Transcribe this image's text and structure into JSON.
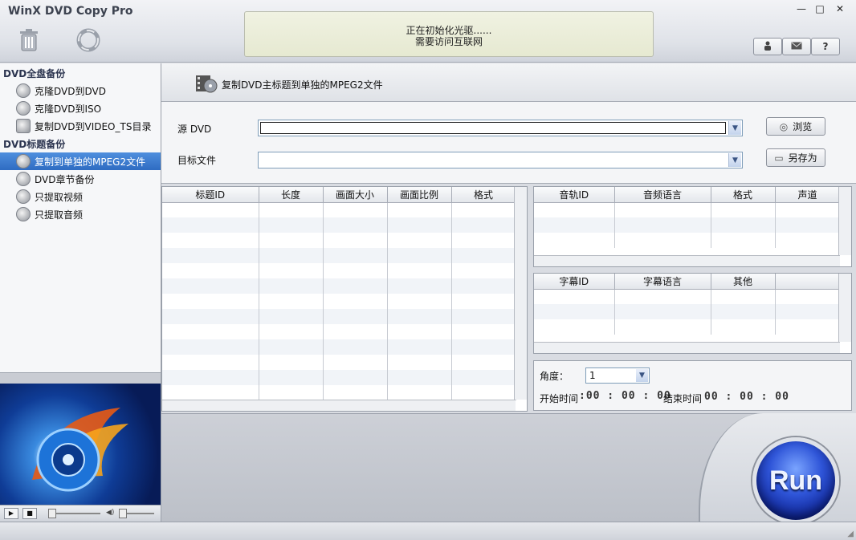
{
  "app": {
    "title": "WinX DVD Copy Pro"
  },
  "toolbar": {
    "delete_icon": "trash-icon",
    "refresh_icon": "refresh-icon"
  },
  "status": {
    "line1": "正在初始化光驱......",
    "line2": "需要访问互联网"
  },
  "window_controls": {
    "minimize": "—",
    "maximize": "□",
    "close": "✕"
  },
  "top_buttons": {
    "user_icon": "user-icon",
    "mail_icon": "mail-icon",
    "help": "?"
  },
  "sidebar": {
    "section1": "DVD全盘备份",
    "section1_items": [
      {
        "label": "克隆DVD到DVD",
        "icon": "disc-icon"
      },
      {
        "label": "克隆DVD到ISO",
        "icon": "iso-icon"
      },
      {
        "label": "复制DVD到VIDEO_TS目录",
        "icon": "folder-icon"
      }
    ],
    "section2": "DVD标题备份",
    "section2_items": [
      {
        "label": "复制到单独的MPEG2文件",
        "icon": "film-icon",
        "selected": true
      },
      {
        "label": "DVD章节备份",
        "icon": "film-icon"
      },
      {
        "label": "只提取视频",
        "icon": "film-icon"
      },
      {
        "label": "只提取音频",
        "icon": "audio-icon"
      }
    ]
  },
  "main": {
    "header_label": "复制DVD主标题到单独的MPEG2文件"
  },
  "form": {
    "source_label": "源 DVD",
    "source_value": "",
    "target_label": "目标文件",
    "target_value": "",
    "browse_label": "浏览",
    "saveas_label": "另存为"
  },
  "titles_table": {
    "headers": [
      "标题ID",
      "长度",
      "画面大小",
      "画面比例",
      "格式"
    ]
  },
  "audio_table": {
    "headers": [
      "音轨ID",
      "音频语言",
      "格式",
      "声道"
    ]
  },
  "subtitle_table": {
    "headers": [
      "字幕ID",
      "字幕语言",
      "其他",
      ""
    ]
  },
  "angle": {
    "label": "角度：",
    "value": "1",
    "start_label": "开始时间",
    "start_value": ":00 : 00 : 00",
    "end_label": "结束时间",
    "end_value": "00 : 00 : 00"
  },
  "run": {
    "label": "Run"
  }
}
